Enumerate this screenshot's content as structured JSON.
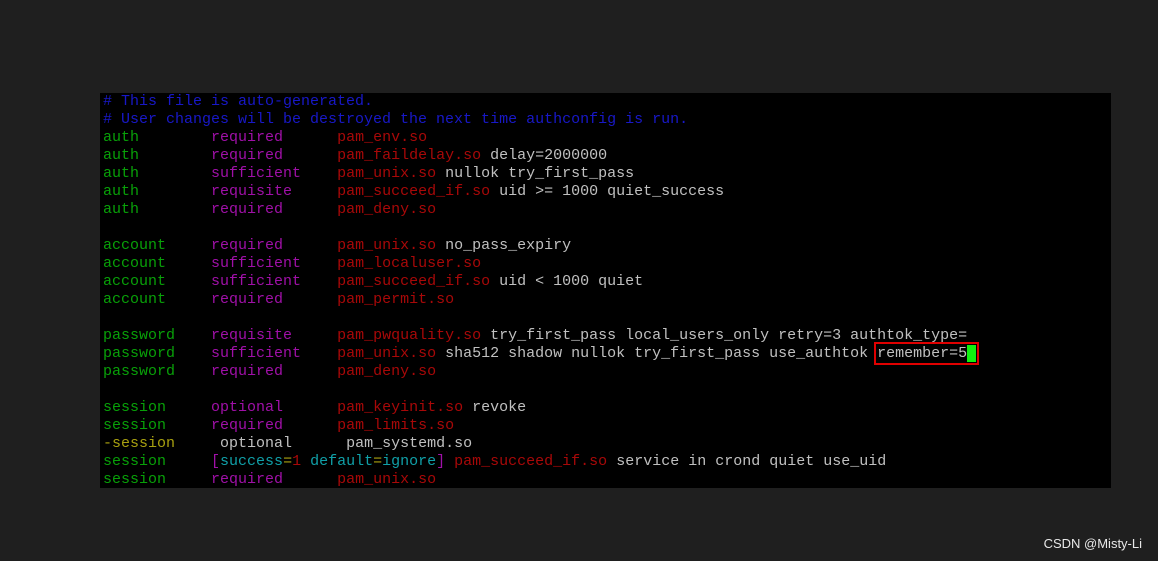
{
  "terminal": {
    "colors": {
      "comment": "#1818c8",
      "green": "#08a008",
      "magenta": "#a010a8",
      "red": "#a80808",
      "white": "#c0c0c0",
      "yellow": "#a8a010",
      "cyan": "#10a0a8",
      "cursor": "#10f010",
      "highlight_box": "#e00000"
    },
    "lines": [
      [
        [
          "# This file is auto-generated.",
          "comment"
        ]
      ],
      [
        [
          "# User changes will be destroyed the next time authconfig is run.",
          "comment"
        ]
      ],
      [
        [
          "auth        ",
          "green"
        ],
        [
          "required      ",
          "magenta"
        ],
        [
          "pam_env.so",
          "red"
        ]
      ],
      [
        [
          "auth        ",
          "green"
        ],
        [
          "required      ",
          "magenta"
        ],
        [
          "pam_faildelay.so",
          "red"
        ],
        [
          " delay=2000000",
          "white"
        ]
      ],
      [
        [
          "auth        ",
          "green"
        ],
        [
          "sufficient    ",
          "magenta"
        ],
        [
          "pam_unix.so",
          "red"
        ],
        [
          " nullok try_first_pass",
          "white"
        ]
      ],
      [
        [
          "auth        ",
          "green"
        ],
        [
          "requisite     ",
          "magenta"
        ],
        [
          "pam_succeed_if.so",
          "red"
        ],
        [
          " uid >= 1000 quiet_success",
          "white"
        ]
      ],
      [
        [
          "auth        ",
          "green"
        ],
        [
          "required      ",
          "magenta"
        ],
        [
          "pam_deny.so",
          "red"
        ]
      ],
      [],
      [
        [
          "account     ",
          "green"
        ],
        [
          "required      ",
          "magenta"
        ],
        [
          "pam_unix.so",
          "red"
        ],
        [
          " no_pass_expiry",
          "white"
        ]
      ],
      [
        [
          "account     ",
          "green"
        ],
        [
          "sufficient    ",
          "magenta"
        ],
        [
          "pam_localuser.so",
          "red"
        ]
      ],
      [
        [
          "account     ",
          "green"
        ],
        [
          "sufficient    ",
          "magenta"
        ],
        [
          "pam_succeed_if.so",
          "red"
        ],
        [
          " uid < 1000 quiet",
          "white"
        ]
      ],
      [
        [
          "account     ",
          "green"
        ],
        [
          "required      ",
          "magenta"
        ],
        [
          "pam_permit.so",
          "red"
        ]
      ],
      [],
      [
        [
          "password    ",
          "green"
        ],
        [
          "requisite     ",
          "magenta"
        ],
        [
          "pam_pwquality.so",
          "red"
        ],
        [
          " try_first_pass local_users_only retry=3 authtok_type=",
          "white"
        ]
      ],
      [
        [
          "password    ",
          "green"
        ],
        [
          "sufficient    ",
          "magenta"
        ],
        [
          "pam_unix.so",
          "red"
        ],
        [
          " sha512 shadow nullok try_first_pass use_authtok ",
          "white"
        ],
        [
          "remember=5",
          "highlight"
        ]
      ],
      [
        [
          "password    ",
          "green"
        ],
        [
          "required      ",
          "magenta"
        ],
        [
          "pam_deny.so",
          "red"
        ]
      ],
      [],
      [
        [
          "session     ",
          "green"
        ],
        [
          "optional      ",
          "magenta"
        ],
        [
          "pam_keyinit.so",
          "red"
        ],
        [
          " revoke",
          "white"
        ]
      ],
      [
        [
          "session     ",
          "green"
        ],
        [
          "required      ",
          "magenta"
        ],
        [
          "pam_limits.so",
          "red"
        ]
      ],
      [
        [
          "-session     ",
          "yellow"
        ],
        [
          "optional      ",
          "white"
        ],
        [
          "pam_systemd.so",
          "white"
        ]
      ],
      [
        [
          "session     ",
          "green"
        ],
        [
          "[",
          "magenta"
        ],
        [
          "success",
          "cyan"
        ],
        [
          "=",
          "yellow"
        ],
        [
          "1",
          "red"
        ],
        [
          " default",
          "cyan"
        ],
        [
          "=",
          "yellow"
        ],
        [
          "ignore",
          "cyan"
        ],
        [
          "]",
          "magenta"
        ],
        [
          " pam_succeed_if.so",
          "red"
        ],
        [
          " service in crond quiet use_uid",
          "white"
        ]
      ],
      [
        [
          "session     ",
          "green"
        ],
        [
          "required      ",
          "magenta"
        ],
        [
          "pam_unix.so",
          "red"
        ]
      ]
    ]
  },
  "watermark": "CSDN @Misty-Li"
}
